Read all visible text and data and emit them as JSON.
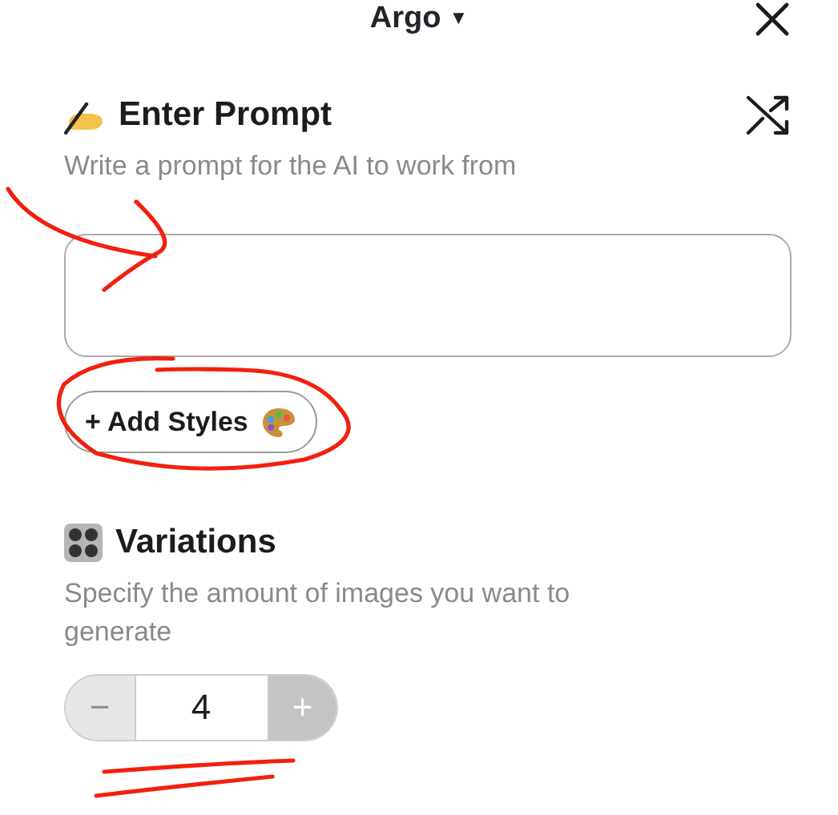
{
  "header": {
    "title": "Argo",
    "caret": "▼"
  },
  "prompt_section": {
    "heading": "Enter Prompt",
    "description": "Write a prompt for the AI to work from",
    "add_styles_button": "+ Add Styles"
  },
  "variations_section": {
    "heading": "Variations",
    "description": "Specify the amount of images you want to generate",
    "stepper": {
      "decrement": {
        "label": "−",
        "disabled": true
      },
      "value": "4",
      "increment": {
        "label": "+",
        "disabled": false
      }
    }
  }
}
